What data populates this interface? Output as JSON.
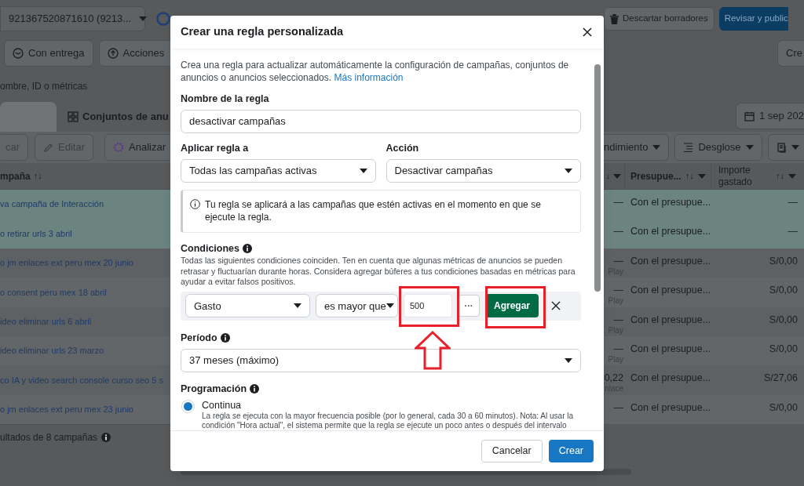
{
  "top_bar": {
    "account": "921367520871610 (9213...",
    "buttons": [
      {
        "label": "Descartar borradores",
        "kind": "plain"
      },
      {
        "label": "Revisar y public",
        "kind": "primary"
      }
    ]
  },
  "filters": {
    "left": [
      "Con entrega",
      "Acciones"
    ],
    "right": "Cre"
  },
  "search": {
    "placeholder": "ombre, ID o métricas"
  },
  "tabs": {
    "label": "Conjuntos de anu",
    "date": "1 sep 202"
  },
  "toolbar": {
    "left": [
      "car",
      "Editar",
      "Analizar"
    ],
    "right": [
      "ndimiento",
      "Desglose"
    ]
  },
  "table": {
    "columns": [
      {
        "label": "mpaña",
        "sort": "↑↓"
      },
      {
        "label": "↓"
      },
      {
        "label": "Presupue...",
        "sort": "↑↓"
      },
      {
        "label": "Importe gastado",
        "sort": "↑↓"
      }
    ],
    "rows": [
      {
        "name": "va campaña de Interacción",
        "column_2": "—",
        "budget": "Con el presupue...",
        "spent": "—",
        "selected": true
      },
      {
        "name": "o retirar urls 3 abril",
        "column_2": "—",
        "budget": "Con el presupue...",
        "spent": "—",
        "selected": true
      },
      {
        "name": "o jm enlaces ext peru mex 20 junio",
        "column_2": "—",
        "column_2_sub": "Play",
        "budget": "Con el presupue...",
        "spent": "S/0,00",
        "selected": false
      },
      {
        "name": "o consent peru mex 18 abril",
        "column_2": "—",
        "column_2_sub": "Play",
        "budget": "Con el presupue...",
        "spent": "S/0,00",
        "selected": false
      },
      {
        "name": "ideo eliminar urls 6 abril",
        "column_2": "—",
        "column_2_sub": "Play",
        "budget": "Con el presupue...",
        "spent": "S/0,00",
        "selected": false
      },
      {
        "name": "ideo eliminar urls 23 marzo",
        "column_2": "—",
        "column_2_sub": "Play",
        "budget": "Con el presupue...",
        "spent": "S/0,00",
        "selected": false
      },
      {
        "name": "co IA y video search console curso seo 5 s",
        "column_2": "0,22",
        "column_2_sub": "nlace",
        "budget": "Con el presupue...",
        "spent": "S/27,06",
        "selected": false
      },
      {
        "name": "o jm enlaces ext peru mex 23 junio",
        "column_2": "—",
        "budget": "Con el presupue...",
        "spent": "S/0,00",
        "selected": false
      }
    ],
    "footer": "ultados de 8 campañas"
  },
  "dialog": {
    "title": "Crear una regla personalizada",
    "intro": "Crea una regla para actualizar automáticamente la configuración de campañas, conjuntos de anuncios o anuncios seleccionados.",
    "intro_link": "Más información",
    "rule_name": {
      "label": "Nombre de la regla",
      "value": "desactivar campañas"
    },
    "apply_to": {
      "label": "Aplicar regla a",
      "value": "Todas las campañas activas"
    },
    "action": {
      "label": "Acción",
      "value": "Desactivar campañas"
    },
    "notice": "Tu regla se aplicará a las campañas que estén activas en el momento en que se ejecute la regla.",
    "conditions": {
      "label": "Condiciones",
      "description": "Todas las siguientes condiciones coinciden. Ten en cuenta que algunas métricas de anuncios se pueden retrasar y fluctuarían durante horas. Considera agregar búferes a tus condiciones basadas en métricas para ayudar a evitar falsos positivos.",
      "metric": "Gasto",
      "operator": "es mayor que",
      "value": "500",
      "more": "···",
      "add_button": "Agregar"
    },
    "period": {
      "label": "Período",
      "value": "37 meses (máximo)"
    },
    "schedule": {
      "label": "Programación",
      "options": [
        {
          "label": "Continua",
          "selected": true,
          "description": "La regla se ejecuta con la mayor frecuencia posible (por lo general, cada 30 a 60 minutos). Nota: Al usar la condición \"Hora actual\", el sistema permite que la regla se ejecute un poco antes o después del intervalo"
        }
      ]
    },
    "buttons": [
      {
        "label": "Cancelar",
        "kind": "secondary"
      },
      {
        "label": "Crear",
        "kind": "primary"
      }
    ]
  }
}
